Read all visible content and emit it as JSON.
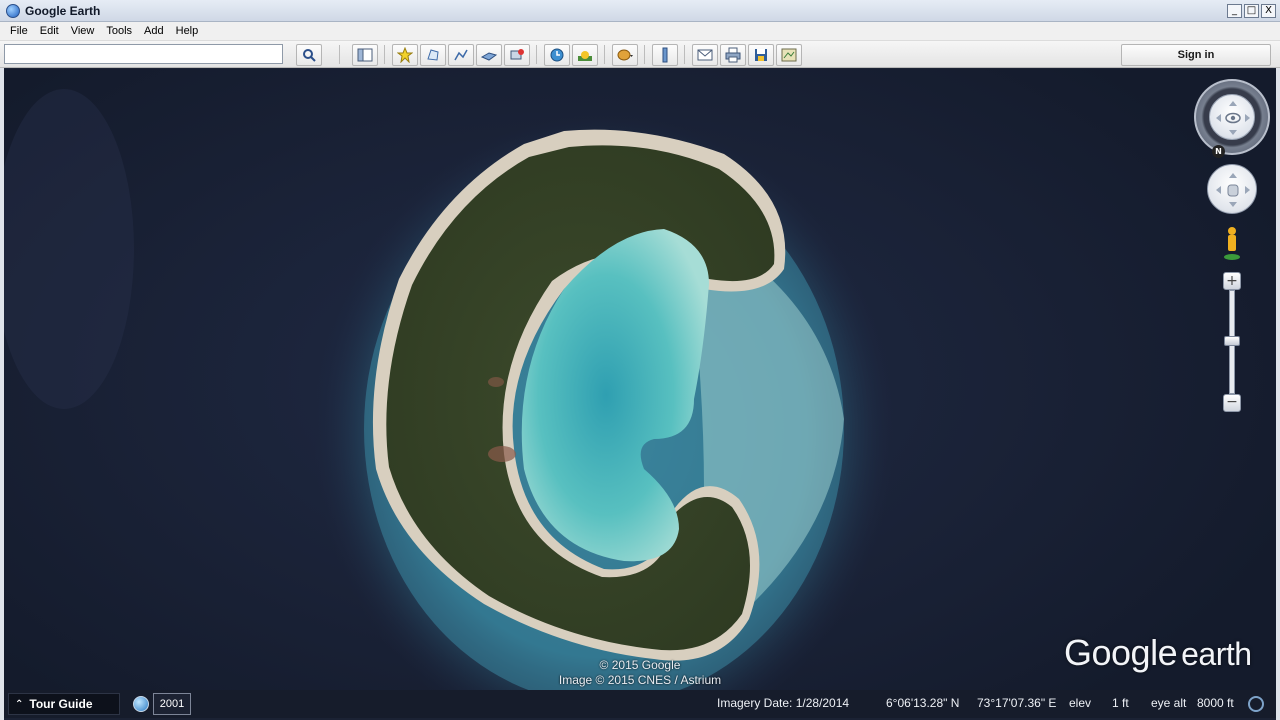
{
  "window": {
    "title": "Google Earth",
    "buttons": [
      "_",
      "□",
      "X"
    ]
  },
  "menu": {
    "items": [
      "File",
      "Edit",
      "View",
      "Tools",
      "Add",
      "Help"
    ]
  },
  "toolbar": {
    "search_value": "",
    "sign_in_label": "Sign in",
    "icons": [
      "search-icon",
      "sidebar-toggle-icon",
      "placemark-icon",
      "polygon-icon",
      "path-icon",
      "image-overlay-icon",
      "record-tour-icon",
      "historical-imagery-icon",
      "sunlight-icon",
      "switch-planets-icon",
      "ruler-icon",
      "email-icon",
      "print-icon",
      "save-image-icon",
      "view-in-maps-icon"
    ]
  },
  "map": {
    "copyright_lines": [
      "© 2015 Google",
      "Image © 2015 CNES / Astrium"
    ],
    "logo_word1": "Google",
    "logo_word2": "earth",
    "north_label": "N",
    "zoom_plus": "+",
    "zoom_minus": "−",
    "colors": {
      "ocean": "#1b2337",
      "reef": "#3f8aa0",
      "lagoon": "#4fb6b8",
      "vegetation": "#3d4a2c",
      "sand": "#d9cfc0"
    }
  },
  "status": {
    "tour_guide_label": "Tour Guide",
    "year": "2001",
    "imagery_date": "Imagery Date: 1/28/2014",
    "latitude": "6°06'13.28\" N",
    "longitude": "73°17'07.36\" E",
    "elev_label": "elev",
    "elev_value": "1 ft",
    "eye_alt_label": "eye alt",
    "eye_alt_value": "8000 ft"
  }
}
